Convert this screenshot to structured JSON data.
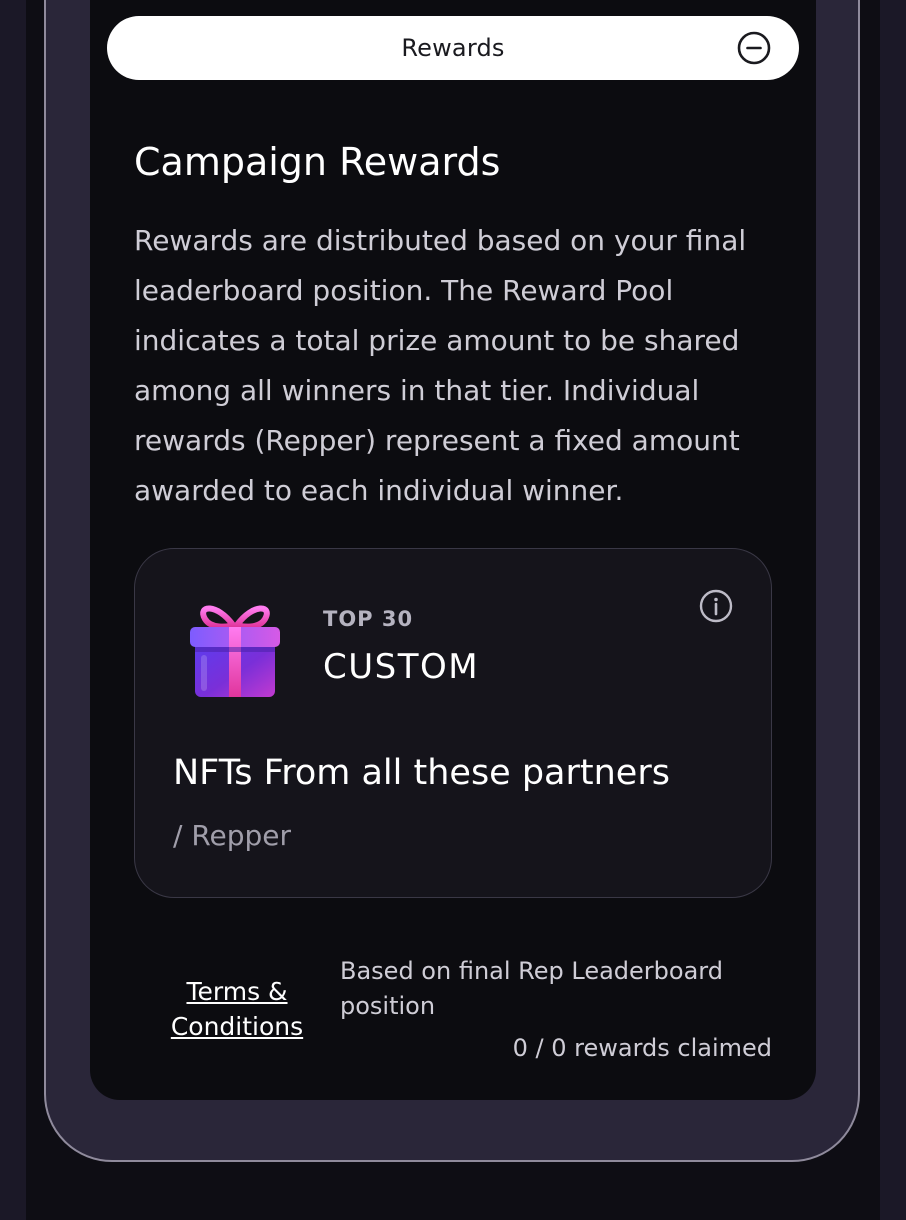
{
  "header": {
    "section_label": "Rewards",
    "collapse_icon": "minus-circle-icon"
  },
  "campaign": {
    "title": "Campaign Rewards",
    "description": "Rewards are distributed based on your final leaderboard position. The Reward Pool indicates a total prize amount to be shared among all winners in that tier. Individual rewards (Repper) represent a fixed amount awarded to each individual winner."
  },
  "reward_card": {
    "icon": "gift-icon",
    "rank": "TOP 30",
    "type": "CUSTOM",
    "info_icon": "info-icon",
    "amount": "NFTs From all these partners",
    "unit": "/ Repper"
  },
  "footer": {
    "terms_label": "Terms & Conditions",
    "basis": "Based on final Rep Leaderboard position",
    "claimed": "0 / 0 rewards claimed"
  },
  "colors": {
    "background": "#1b1827",
    "panel": "#0c0c10",
    "card": "#15141b",
    "text_primary": "#ffffff",
    "text_secondary": "#cfcdd6",
    "gift_purple": "#7b3cf0",
    "gift_pink": "#e24ad8"
  }
}
